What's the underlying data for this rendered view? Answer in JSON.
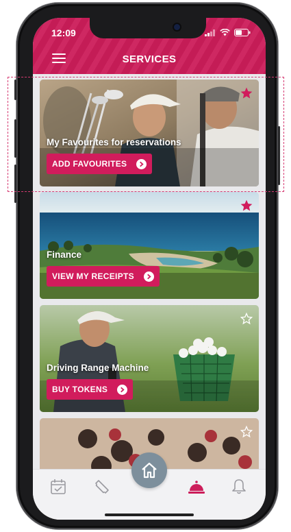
{
  "status": {
    "time": "12:09"
  },
  "header": {
    "title": "SERVICES"
  },
  "cards": [
    {
      "label": "My Favourites for reservations",
      "button": "ADD FAVOURITES",
      "starred": true
    },
    {
      "label": "Finance",
      "button": "VIEW MY RECEIPTS",
      "starred": true
    },
    {
      "label": "Driving Range Machine",
      "button": "BUY TOKENS",
      "starred": false
    },
    {
      "label": "",
      "button": "",
      "starred": false
    }
  ],
  "tabbar": {
    "items": [
      "calendar-icon",
      "ticket-icon",
      "home-icon",
      "service-bell-icon",
      "notification-bell-icon"
    ],
    "active": "service-bell-icon"
  },
  "colors": {
    "accent": "#cc1d5a",
    "button": "#d11c5c",
    "home": "#7d8f9c"
  }
}
